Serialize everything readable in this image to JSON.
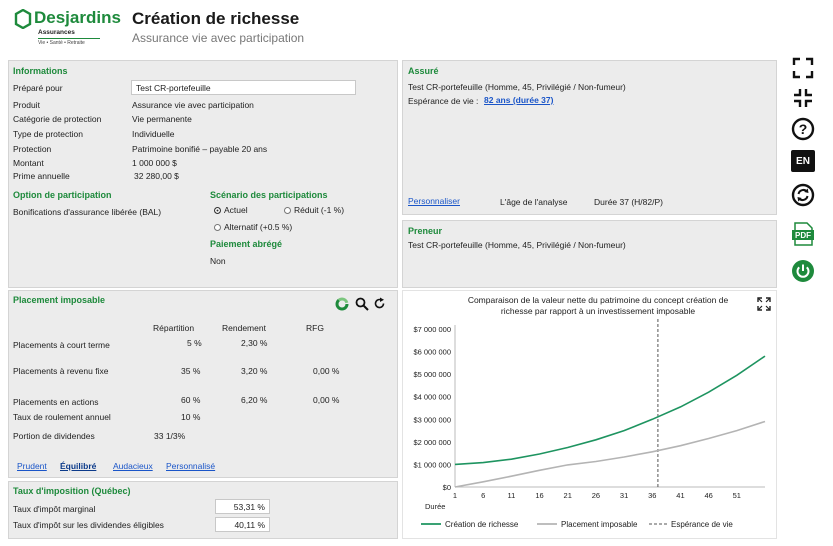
{
  "brand": {
    "name": "Desjardins",
    "sub": "Assurances",
    "tag": "Vie • Santé • Retraite",
    "color": "#1e8a3c"
  },
  "header": {
    "title": "Création de richesse",
    "subtitle": "Assurance vie avec participation"
  },
  "informations": {
    "title": "Informations",
    "prepared_label": "Préparé pour",
    "prepared_value": "Test CR-portefeuille",
    "rows": [
      {
        "label": "Produit",
        "value": "Assurance vie avec participation"
      },
      {
        "label": "Catégorie de protection",
        "value": "Vie permanente"
      },
      {
        "label": "Type de protection",
        "value": "Individuelle"
      },
      {
        "label": "Protection",
        "value": "Patrimoine bonifié – payable 20 ans"
      },
      {
        "label": "Montant",
        "value": "1 000 000 $"
      },
      {
        "label": "Prime annuelle",
        "value": "32 280,00 $"
      }
    ],
    "option_title": "Option de participation",
    "option_value": "Bonifications d'assurance libérée (BAL)",
    "scenario_title": "Scénario des participations",
    "scenario_options": [
      "Actuel",
      "Réduit (-1 %)",
      "Alternatif (+0.5 %)"
    ],
    "paiement_title": "Paiement abrégé",
    "paiement_value": "Non"
  },
  "assure": {
    "title": "Assuré",
    "line1": "Test CR-portefeuille (Homme, 45, Privilégié / Non-fumeur)",
    "esperance_label": "Espérance de vie :",
    "esperance_value": "82 ans (durée 37)",
    "personnaliser": "Personnaliser",
    "age_label": "L'âge de l'analyse",
    "duree_value": "Durée 37  (H/82/P)"
  },
  "preneur": {
    "title": "Preneur",
    "line1": "Test CR-portefeuille (Homme, 45, Privilégié / Non-fumeur)"
  },
  "placement": {
    "title": "Placement imposable",
    "headers": [
      "Répartition",
      "Rendement",
      "RFG"
    ],
    "rows": [
      {
        "label": "Placements à court terme",
        "rep": "5 %",
        "rend": "2,30 %",
        "rfg": ""
      },
      {
        "label": "Placements à revenu fixe",
        "rep": "35 %",
        "rend": "3,20 %",
        "rfg": "0,00 %"
      },
      {
        "label": "Placements en actions",
        "rep": "60 %",
        "rend": "6,20 %",
        "rfg": "0,00 %"
      }
    ],
    "roulement_label": "Taux de roulement annuel",
    "roulement_value": "10 %",
    "dividendes_label": "Portion de dividendes",
    "dividendes_value": "33 1/3%",
    "profiles": [
      "Prudent",
      "Équilibré",
      "Audacieux",
      "Personnalisé"
    ]
  },
  "taux": {
    "title": "Taux d'imposition (Québec)",
    "marginal_label": "Taux d'impôt marginal",
    "marginal_value": "53,31 %",
    "dividendes_label": "Taux d'impôt sur les dividendes éligibles",
    "dividendes_value": "40,11 %"
  },
  "sidebar": {
    "en_label": "EN",
    "pdf_label": "PDF"
  },
  "chart_data": {
    "type": "line",
    "title": "Comparaison de la valeur nette du patrimoine du concept création de richesse par rapport à un investissement imposable",
    "xlabel": "Durée",
    "ylabel": "",
    "x_ticks": [
      1,
      6,
      11,
      16,
      21,
      26,
      31,
      36,
      41,
      46,
      51
    ],
    "y_ticks": [
      "$0",
      "$1 000 000",
      "$2 000 000",
      "$3 000 000",
      "$4 000 000",
      "$5 000 000",
      "$6 000 000",
      "$7 000 000"
    ],
    "xlim": [
      1,
      56
    ],
    "ylim": [
      0,
      7000000
    ],
    "series": [
      {
        "name": "Création de richesse",
        "color": "#1e9460",
        "x": [
          1,
          6,
          11,
          16,
          21,
          26,
          31,
          36,
          41,
          46,
          51,
          56
        ],
        "values": [
          1000000,
          1080000,
          1230000,
          1460000,
          1750000,
          2090000,
          2500000,
          3000000,
          3550000,
          4200000,
          4950000,
          5800000
        ]
      },
      {
        "name": "Placement imposable",
        "color": "#b4b4b4",
        "x": [
          1,
          6,
          11,
          16,
          21,
          26,
          31,
          36,
          41,
          46,
          51,
          56
        ],
        "values": [
          0,
          230000,
          480000,
          740000,
          980000,
          1130000,
          1330000,
          1560000,
          1830000,
          2150000,
          2500000,
          2900000
        ]
      }
    ],
    "esperance_line": {
      "name": "Espérance de vie",
      "x": 37
    }
  }
}
